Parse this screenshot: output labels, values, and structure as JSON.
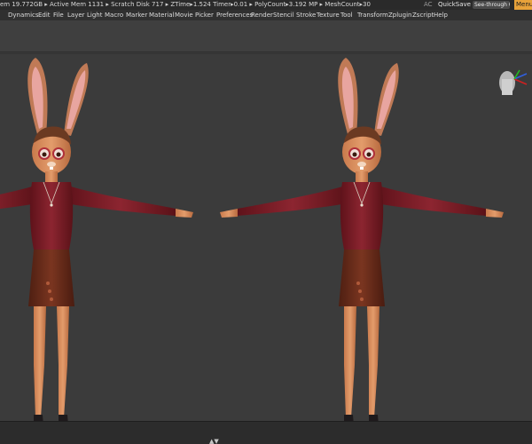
{
  "status": {
    "stats_text": "em 19.772GB ▸ Active Mem 1131 ▸ Scratch Disk 717 ▸ ZTime▸1.524 Timer▸0.01 ▸ PolyCount▸3.192 MP ▸ MeshCount▸30",
    "ac_label": "AC",
    "quicksave_label": "QuickSave",
    "seethrough_label": "See-through",
    "seethrough_value": "0",
    "seethrough_level": 0,
    "menus_label": "Menus"
  },
  "menu": {
    "items": [
      "Dynamics",
      "Edit",
      "File",
      "Layer",
      "Light",
      "Macro",
      "Marker",
      "Material",
      "Movie",
      "Picker",
      "Preferences",
      "Render",
      "Stencil",
      "Stroke",
      "Texture",
      "Tool",
      "Transform",
      "Zplugin",
      "Zscript",
      "Help"
    ]
  },
  "viewport": {
    "models": [
      {
        "name": "bunny-character"
      },
      {
        "name": "bunny-character"
      }
    ]
  },
  "bottombar": {
    "toggle_icon": "chevron-up-icon"
  },
  "colors": {
    "accent": "#e8a23a",
    "sweater": "#7d1c24",
    "skirt": "#6e2e1c",
    "skin": "#d98c5c",
    "background": "#3b3b3b"
  }
}
